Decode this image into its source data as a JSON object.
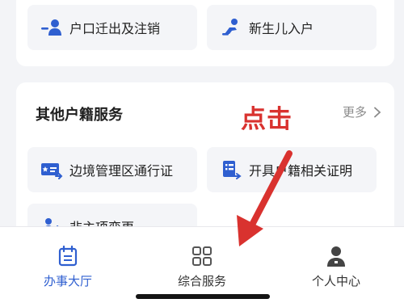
{
  "top_services": [
    {
      "label": "户口迁出及注销",
      "icon": "person-minus-icon"
    },
    {
      "label": "新生儿入户",
      "icon": "baby-crawl-icon"
    }
  ],
  "other_section": {
    "title": "其他户籍服务",
    "more_label": "更多",
    "items": [
      {
        "label": "边境管理区通行证",
        "icon": "pass-card-icon"
      },
      {
        "label": "开具户籍相关证明",
        "icon": "document-list-icon"
      },
      {
        "label": "非主项变更",
        "icon": "person-change-icon"
      }
    ]
  },
  "annotation": {
    "text": "点击",
    "color": "#d9322f"
  },
  "tabbar": {
    "tabs": [
      {
        "label": "办事大厅",
        "icon": "calendar-list-icon",
        "active": true
      },
      {
        "label": "综合服务",
        "icon": "grid-apps-icon",
        "active": false
      },
      {
        "label": "个人中心",
        "icon": "person-icon",
        "active": false
      }
    ]
  },
  "colors": {
    "accent": "#2f5fd0",
    "annotation": "#d9322f"
  }
}
